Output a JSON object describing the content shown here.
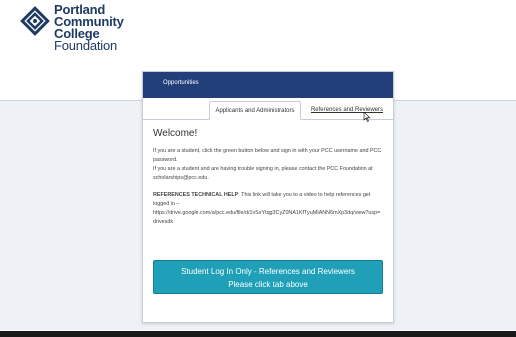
{
  "logo": {
    "line1": "Portland",
    "line2": "Community",
    "line3": "College",
    "line4": "Foundation"
  },
  "header": {
    "nav_item": "Opportunities"
  },
  "tabs": [
    {
      "label": "Applicants and Administrators",
      "active": true
    },
    {
      "label": "References and Reviewers",
      "active": false
    }
  ],
  "content": {
    "welcome": "Welcome!",
    "p1": "If you are a student, click the green button below and sign in with your PCC username and PCC password.",
    "p2": "If you are a student and are having trouble signing in, please contact the PCC Foundation at scholarships@pcc.edu.",
    "help_title": "REFERENCES TECHNICAL HELP",
    "help_text": ": This link will take you to a video to help references get logged in –",
    "help_url": "https://drive.google.com/a/pcc.edu/file/d/1vSxYtqg3CyZ0NA1KfTyuMIANN6mXp3dq/view?usp=drivesdk"
  },
  "login_button": {
    "line1": "Student Log In Only - References and Reviewers",
    "line2": "Please click tab above"
  },
  "colors": {
    "header_bg": "#233f7a",
    "button_bg": "#1fa0b8",
    "logo_blue": "#1f3a63"
  },
  "icons": {
    "logo_mark": "pcc-spiral-logo-icon",
    "cursor": "mouse-pointer-icon"
  }
}
